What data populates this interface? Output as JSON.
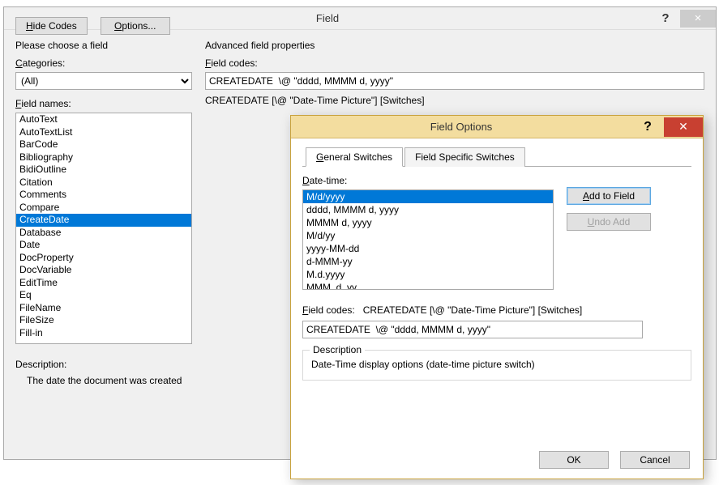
{
  "field_dialog": {
    "title": "Field",
    "choose_label": "Please choose a field",
    "categories_label": "Categories:",
    "category_selected": "(All)",
    "field_names_label": "Field names:",
    "field_names": [
      "AutoText",
      "AutoTextList",
      "BarCode",
      "Bibliography",
      "BidiOutline",
      "Citation",
      "Comments",
      "Compare",
      "CreateDate",
      "Database",
      "Date",
      "DocProperty",
      "DocVariable",
      "EditTime",
      "Eq",
      "FileName",
      "FileSize",
      "Fill-in"
    ],
    "field_names_selected": "CreateDate",
    "description_label": "Description:",
    "description_text": "The date the document was created",
    "hide_codes_btn": "Hide Codes",
    "options_btn": "Options...",
    "advanced_label": "Advanced field properties",
    "field_codes_label": "Field codes:",
    "field_codes_value": "CREATEDATE  \\@ \"dddd, MMMM d, yyyy\"",
    "syntax_text": "CREATEDATE [\\@ \"Date-Time Picture\"] [Switches]"
  },
  "options_dialog": {
    "title": "Field Options",
    "tabs": {
      "general": "General Switches",
      "specific": "Field Specific Switches"
    },
    "active_tab": "general",
    "date_time_label": "Date-time:",
    "date_time_items": [
      "M/d/yyyy",
      "dddd, MMMM d, yyyy",
      "MMMM d, yyyy",
      "M/d/yy",
      "yyyy-MM-dd",
      "d-MMM-yy",
      "M.d.yyyy",
      "MMM. d, yy"
    ],
    "date_time_selected": "M/d/yyyy",
    "add_to_field_btn": "Add to Field",
    "undo_add_btn": "Undo Add",
    "field_codes_label": "Field codes:",
    "syntax_text": "CREATEDATE [\\@ \"Date-Time Picture\"] [Switches]",
    "field_codes_value": "CREATEDATE  \\@ \"dddd, MMMM d, yyyy\"",
    "description_group": "Description",
    "description_text": "Date-Time display options (date-time picture switch)",
    "ok_btn": "OK",
    "cancel_btn": "Cancel"
  }
}
